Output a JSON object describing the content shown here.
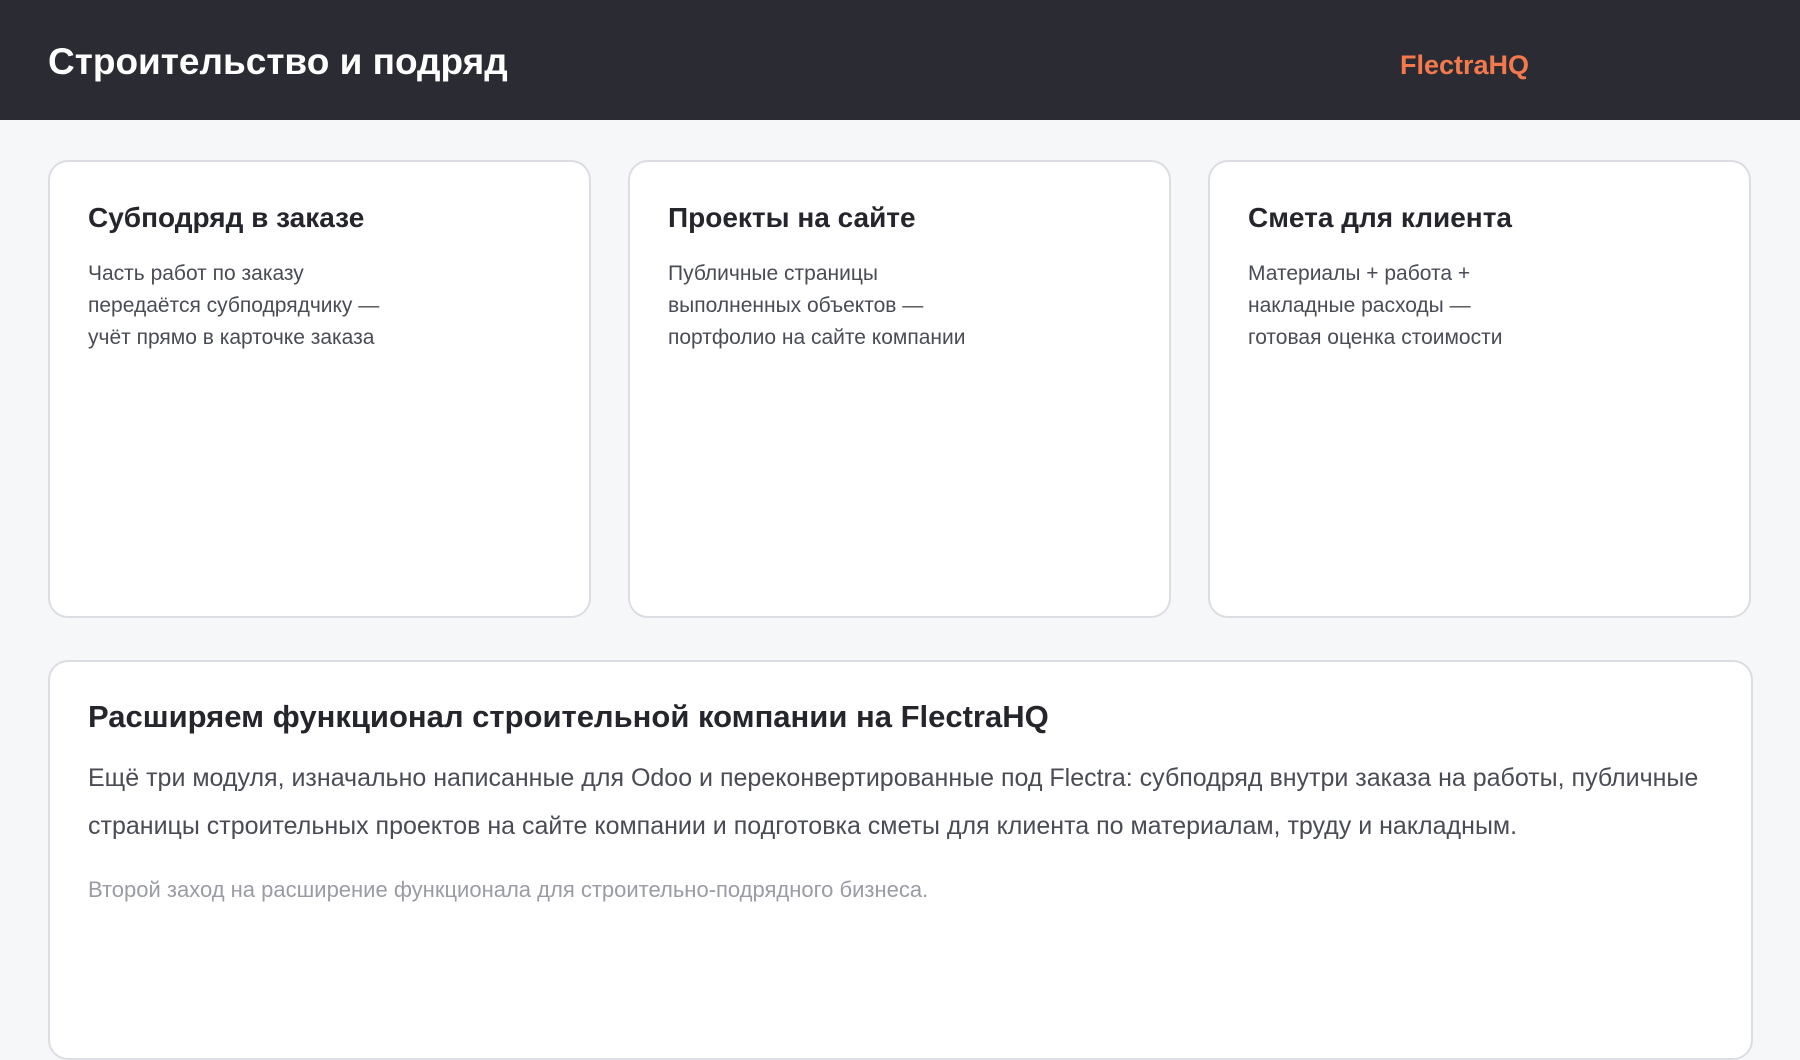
{
  "header": {
    "title": "Строительство и подряд",
    "brand": "FlectraHQ",
    "brand_color": "#f47a4d",
    "background_color": "#2a2b33"
  },
  "cards": [
    {
      "title": "Субподряд в заказе",
      "description": "Часть работ по заказу\nпередаётся субподрядчику —\nучёт прямо в карточке заказа"
    },
    {
      "title": "Проекты на сайте",
      "description": "Публичные страницы\nвыполненных объектов —\nпортфолио на сайте компании"
    },
    {
      "title": "Смета для клиента",
      "description": "Материалы + работа +\nнакладные расходы —\nготовая оценка стоимости"
    }
  ],
  "panel": {
    "title": "Расширяем функционал строительной компании на FlectraHQ",
    "body": "Ещё три модуля, изначально написанные для Odoo и переконвертированные под Flectra: субподряд внутри заказа на работы, публичные страницы строительных проектов на сайте компании и подготовка сметы для клиента по материалам, труду и накладным.",
    "note": "Второй заход на расширение функционала для строительно-подрядного бизнеса."
  }
}
